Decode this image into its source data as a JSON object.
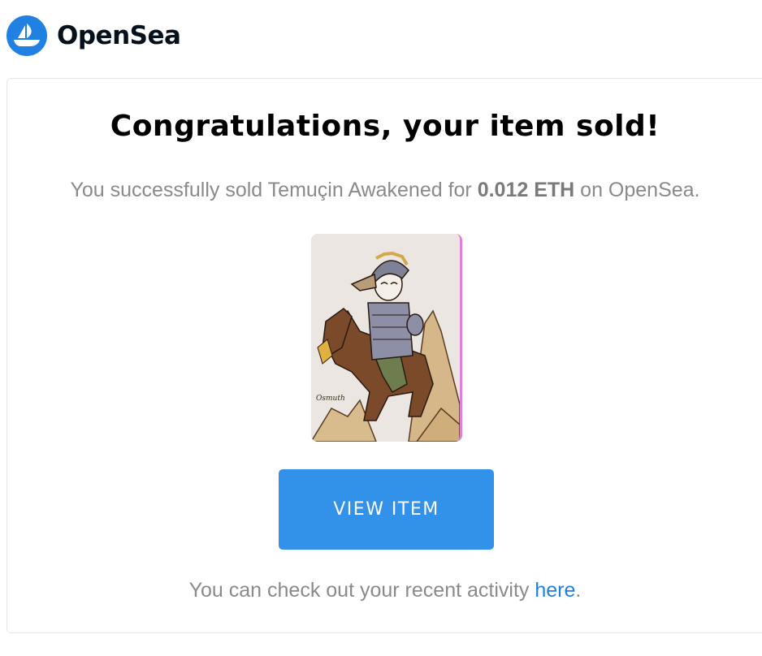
{
  "header": {
    "brand": "OpenSea",
    "logo_icon": "opensea-boat-logo-icon",
    "logo_color": "#2081e2"
  },
  "card": {
    "title": "Congratulations, your item sold!",
    "message": {
      "prefix": "You successfully sold Temuçin Awakened for ",
      "price": "0.012 ETH",
      "suffix": " on OpenSea."
    },
    "image_label": "nft-artwork-rider-on-horse",
    "button": {
      "label": "VIEW ITEM",
      "color": "#3291e9"
    },
    "footer": {
      "prefix": "You can check out your recent activity ",
      "link": "here",
      "suffix": "."
    }
  }
}
